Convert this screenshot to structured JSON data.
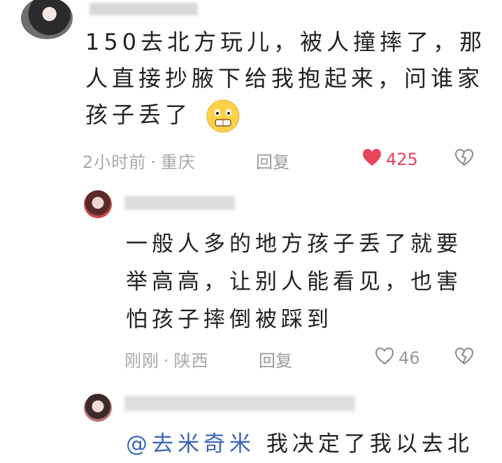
{
  "comment": {
    "text": "150去北方玩儿，被人撞摔了，那人直接抄腋下给我抱起来，问谁家孩子丢了",
    "emoji": "grimace-emoji",
    "time": "2小时前",
    "location": "重庆",
    "reply_label": "回复",
    "likes": "425",
    "liked": true
  },
  "reply1": {
    "text": "一般人多的地方孩子丢了就要举高高，让别人能看见，也害怕孩子摔倒被踩到",
    "time": "刚刚",
    "location": "陕西",
    "reply_label": "回复",
    "likes": "46",
    "liked": false
  },
  "reply2": {
    "mention": "@去米奇米",
    "text": "我决定了我以去北"
  },
  "colors": {
    "like_red": "#e8455c",
    "meta_gray": "#a9a9a9",
    "mention_blue": "#3a66b8"
  }
}
